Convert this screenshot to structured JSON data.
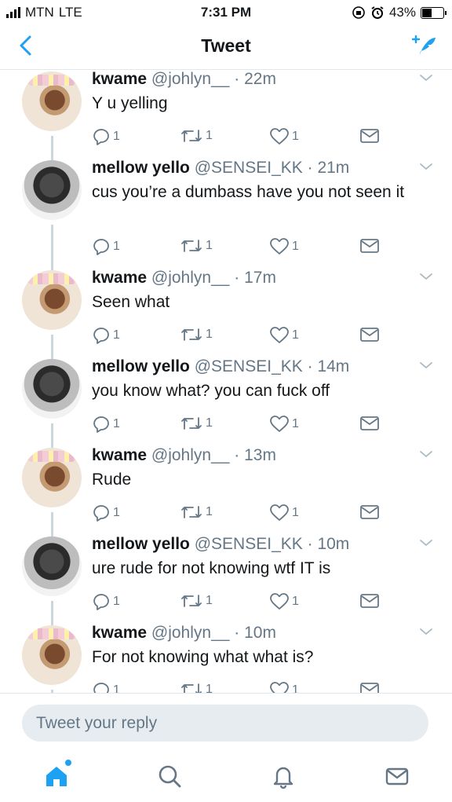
{
  "status_bar": {
    "carrier": "MTN",
    "network": "LTE",
    "time": "7:31 PM",
    "battery_text": "43%",
    "battery_level": 0.43
  },
  "nav": {
    "title": "Tweet",
    "back_icon": "chevron-left-icon",
    "compose_icon": "compose-tweet-icon"
  },
  "colors": {
    "accent": "#1da1f2",
    "muted": "#657786",
    "divider": "#e1e8ed"
  },
  "tweets": [
    {
      "name": "kwame",
      "handle": "@johlyn__",
      "time": "22m",
      "text": "Y u yelling",
      "reply_count": "1",
      "retweet_count": "1",
      "like_count": "1"
    },
    {
      "name": "mellow yello",
      "handle": "@SENSEI_KK",
      "time": "21m",
      "text": "cus you’re a dumbass have you not seen it",
      "reply_count": "1",
      "retweet_count": "1",
      "like_count": "1"
    },
    {
      "name": "kwame",
      "handle": "@johlyn__",
      "time": "17m",
      "text": "Seen what",
      "reply_count": "1",
      "retweet_count": "1",
      "like_count": "1"
    },
    {
      "name": "mellow yello",
      "handle": "@SENSEI_KK",
      "time": "14m",
      "text": "you know what? you can fuck off",
      "reply_count": "1",
      "retweet_count": "1",
      "like_count": "1"
    },
    {
      "name": "kwame",
      "handle": "@johlyn__",
      "time": "13m",
      "text": "Rude",
      "reply_count": "1",
      "retweet_count": "1",
      "like_count": "1"
    },
    {
      "name": "mellow yello",
      "handle": "@SENSEI_KK",
      "time": "10m",
      "text": "ure rude for not knowing wtf IT is",
      "reply_count": "1",
      "retweet_count": "1",
      "like_count": "1"
    },
    {
      "name": "kwame",
      "handle": "@johlyn__",
      "time": "10m",
      "text": "For not knowing what what is?",
      "reply_count": "1",
      "retweet_count": "1",
      "like_count": "1"
    }
  ],
  "reply": {
    "placeholder": "Tweet your reply"
  },
  "tabbar": {
    "items": [
      "home-icon",
      "search-icon",
      "notifications-icon",
      "messages-icon"
    ]
  }
}
